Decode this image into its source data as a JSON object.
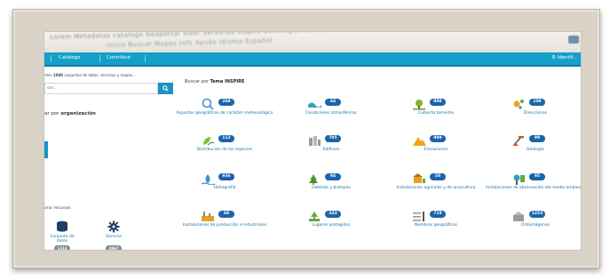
{
  "header": {
    "ghost_text_1": "Lorem Metadatos catalogo  Geoportal  Visor  Servicios  Inspire  Descargas  Contacto",
    "ghost_text_2": "Inicio   Buscar   Mapas   Info   Ayuda   Idioma  Español"
  },
  "navbar": {
    "items": [
      "Catálogo",
      "Contribuir"
    ],
    "right_label": "⚙ Identif..."
  },
  "left": {
    "count_prefix": "ntes ",
    "count_value": "1040",
    "count_suffix": " conjuntos de datos, servicios y mapas...",
    "search_placeholder": "dar...",
    "org_prefix": "ar por ",
    "org_bold": "organización",
    "resources_label": "orar recursos",
    "resources": [
      {
        "icon": "database-icon",
        "label_line1": "Conjunto de",
        "label_line2": "datos",
        "count": "1314"
      },
      {
        "icon": "gear-icon",
        "label_line1": "Servicio",
        "label_line2": "",
        "count": "4967"
      }
    ]
  },
  "categories": {
    "title_prefix": "Buscar por ",
    "title_bold": "Tema INSPIRE",
    "items": [
      {
        "icon": "geographic-aspects-icon",
        "count": "268",
        "label": "Aspectos geográficos de carácter meteorológico",
        "color": "#4a8fd6"
      },
      {
        "icon": "atmospheric-conditions-icon",
        "count": "64",
        "label": "Condiciones atmosféricas",
        "color": "#3aa0b8"
      },
      {
        "icon": "land-cover-icon",
        "count": "998",
        "label": "Cubierta terrestre",
        "color": "#8ab233"
      },
      {
        "icon": "addresses-icon",
        "count": "109",
        "label": "Direcciones",
        "color": "#f0a51a"
      },
      {
        "icon": "species-distribution-icon",
        "count": "112",
        "label": "Distribución de las especies",
        "color": "#7fbf3f"
      },
      {
        "icon": "buildings-icon",
        "count": "795",
        "label": "Edificios",
        "color": "#9a9a9a"
      },
      {
        "icon": "elevation-icon",
        "count": "989",
        "label": "Elevaciones",
        "color": "#f0a51a"
      },
      {
        "icon": "geology-icon",
        "count": "99",
        "label": "Geología",
        "color": "#d25a2a"
      },
      {
        "icon": "hydrography-icon",
        "count": "936",
        "label": "Hidrografía",
        "color": "#3a8fd6"
      },
      {
        "icon": "habitats-icon",
        "count": "94",
        "label": "Hábitats y biotopos",
        "color": "#6aa83a"
      },
      {
        "icon": "agricultural-facilities-icon",
        "count": "58",
        "label": "Instalaciones agrícolas y de acuicultura",
        "color": "#e8a020"
      },
      {
        "icon": "observation-facilities-icon",
        "count": "95",
        "label": "Instalaciones de observación del medio ambiente",
        "color": "#2aa0c8"
      },
      {
        "icon": "production-facilities-icon",
        "count": "69",
        "label": "Instalaciones de producción e industriales",
        "color": "#e8a020"
      },
      {
        "icon": "protected-sites-icon",
        "count": "343",
        "label": "Lugares protegidos",
        "color": "#6aa83a"
      },
      {
        "icon": "geographic-names-icon",
        "count": "719",
        "label": "Nombres geográficos",
        "color": "#9a9a9a"
      },
      {
        "icon": "orthoimagery-icon",
        "count": "1253",
        "label": "Ortoimágenes",
        "color": "#9a9a9a"
      }
    ]
  }
}
